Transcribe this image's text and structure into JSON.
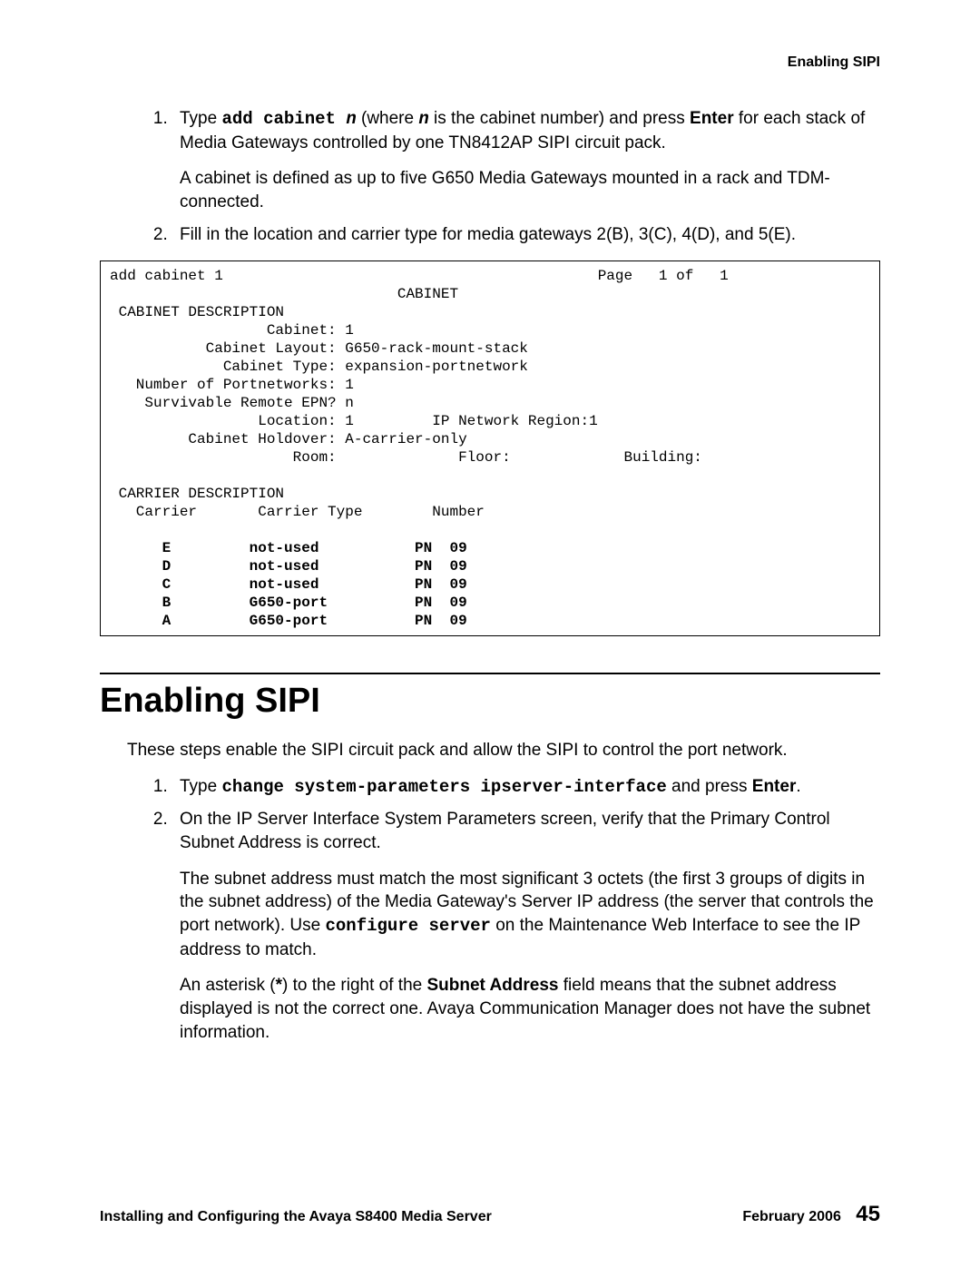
{
  "running_header": "Enabling SIPI",
  "step1": {
    "pre": "Type ",
    "cmd": "add cabinet ",
    "n": "n",
    "mid": " (where ",
    "n2": "n",
    "mid2": " is the cabinet number) and press ",
    "enter": "Enter",
    "tail": " for each stack of Media Gateways  controlled by one TN8412AP SIPI circuit pack.",
    "para2": "A cabinet is defined as up to five G650 Media Gateways mounted in a rack and TDM-connected."
  },
  "step2": "Fill in the location and carrier type for media gateways 2(B), 3(C), 4(D), and 5(E).",
  "terminal": {
    "cmd": "add cabinet 1",
    "page": "Page   1 of   1",
    "title": "CABINET",
    "cab_desc": " CABINET DESCRIPTION",
    "cabinet_lbl": "                  Cabinet: ",
    "cabinet_val": "1",
    "layout_lbl": "           Cabinet Layout: ",
    "layout_val": "G650-rack-mount-stack",
    "type_lbl": "             Cabinet Type: ",
    "type_val": "expansion-portnetwork",
    "pn_lbl": "   Number of Portnetworks: ",
    "pn_val": "1",
    "sre_lbl": "    Survivable Remote EPN? ",
    "sre_val": "n",
    "loc_lbl": "                 Location: ",
    "loc_val": "1",
    "ipnr_lbl": "         IP Network Region:",
    "ipnr_val": "1",
    "holdover_lbl": "         Cabinet Holdover: ",
    "holdover_val": "A-carrier-only",
    "room": "                     Room:              Floor:             Building:",
    "car_desc": " CARRIER DESCRIPTION",
    "car_hdr": "   Carrier       Carrier Type        Number",
    "rows": [
      {
        "c": "E",
        "t": "not-used",
        "n": "PN  09"
      },
      {
        "c": "D",
        "t": "not-used",
        "n": "PN  09"
      },
      {
        "c": "C",
        "t": "not-used",
        "n": "PN  09"
      },
      {
        "c": "B",
        "t": "G650-port",
        "n": "PN  09"
      },
      {
        "c": "A",
        "t": "G650-port",
        "n": "PN  09"
      }
    ]
  },
  "section_title": "Enabling SIPI",
  "intro": "These steps enable the SIPI circuit pack and allow the SIPI to control the port network.",
  "s2_step1": {
    "pre": "Type ",
    "cmd": "change system-parameters ipserver-interface",
    "mid": " and press ",
    "enter": "Enter",
    "tail": "."
  },
  "s2_step2": {
    "p1": "On the IP Server Interface System Parameters screen, verify that the Primary Control Subnet Address is correct.",
    "p2_a": "The subnet address must match the most significant 3 octets (the first 3 groups of digits in the subnet address) of the Media Gateway's Server IP address (the server that controls the port network). Use ",
    "p2_cmd": "configure server",
    "p2_b": " on the Maintenance Web Interface to see the IP address to match.",
    "p3_a": "An asterisk (",
    "p3_ast": "*",
    "p3_b": ") to the right of the ",
    "p3_bold": "Subnet Address",
    "p3_c": " field means that the subnet address displayed is not the correct one. Avaya Communication Manager does not have the subnet information."
  },
  "footer": {
    "left": "Installing and Configuring the Avaya S8400 Media Server",
    "date": "February 2006",
    "page": "45"
  }
}
